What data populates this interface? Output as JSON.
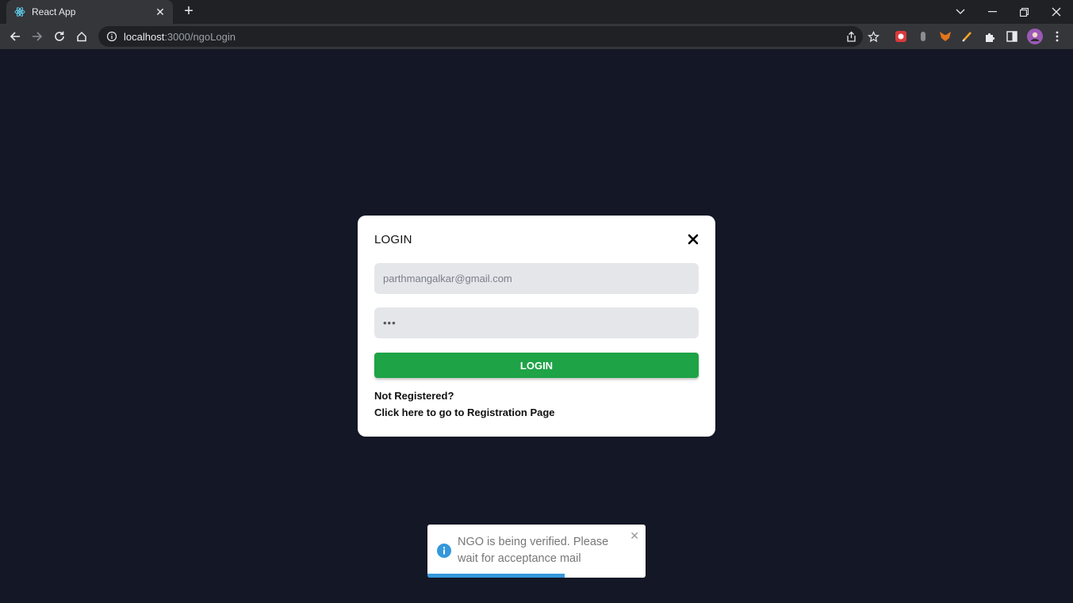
{
  "browser": {
    "tab_title": "React App",
    "url_host": "localhost",
    "url_path": ":3000/ngoLogin"
  },
  "modal": {
    "title": "LOGIN",
    "email_value": "parthmangalkar@gmail.com",
    "password_value": "•••",
    "login_button": "LOGIN",
    "not_registered": "Not Registered?",
    "registration_link": "Click here to go to Registration Page"
  },
  "toast": {
    "message": "NGO is being verified. Please wait for acceptance mail",
    "progress": 0.63
  },
  "colors": {
    "page_background": "#131726",
    "login_button": "#1ea346",
    "toast_info": "#3498db"
  }
}
